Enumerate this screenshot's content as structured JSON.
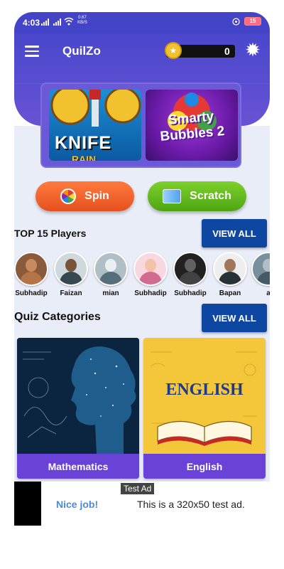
{
  "status_bar": {
    "time": "4:03",
    "speed": "0.67 KB/S",
    "battery": "15"
  },
  "app": {
    "title": "QuilZo",
    "coins": "0"
  },
  "games": [
    {
      "title_top": "KNIFE",
      "title_bottom": "RAIN"
    },
    {
      "title": "Smarty Bubbles 2"
    }
  ],
  "actions": {
    "spin": "Spin",
    "scratch": "Scratch"
  },
  "top_players": {
    "title": "TOP 15 Players",
    "view_all": "VIEW ALL",
    "players": [
      {
        "name": "Subhadip"
      },
      {
        "name": "Faizan"
      },
      {
        "name": "mian"
      },
      {
        "name": "Subhadip"
      },
      {
        "name": "Subhadip"
      },
      {
        "name": "Bapan"
      },
      {
        "name": "a"
      }
    ]
  },
  "quiz": {
    "title": "Quiz Categories",
    "view_all": "VIEW ALL",
    "categories": [
      {
        "label": "Mathematics"
      },
      {
        "label": "English",
        "art_text": "ENGLISH"
      }
    ]
  },
  "ad": {
    "badge": "Test Ad",
    "cta": "Nice job!",
    "text": "This is a 320x50 test ad."
  },
  "colors": {
    "header": "#4a47cc",
    "view_all": "#0d47a1",
    "category_label": "#6a42d8",
    "spin": "#ff7a3d",
    "scratch": "#7dd12c"
  }
}
